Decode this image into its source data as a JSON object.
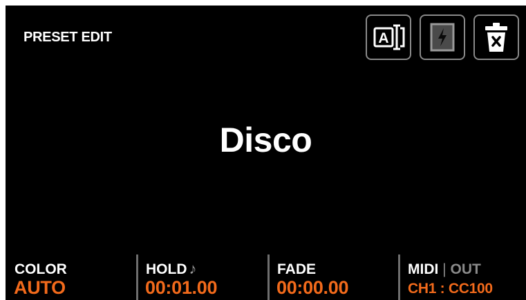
{
  "header": {
    "title": "PRESET EDIT"
  },
  "toolbar": {
    "rename_icon": "rename-text-icon",
    "trigger_icon": "lightning-icon",
    "delete_icon": "trash-icon"
  },
  "preset": {
    "name": "Disco"
  },
  "params": {
    "color": {
      "label": "COLOR",
      "value": "AUTO"
    },
    "hold": {
      "label": "HOLD",
      "icon": "music-note-icon",
      "value": "00:01.00"
    },
    "fade": {
      "label": "FADE",
      "value": "00:00.00"
    },
    "midi": {
      "label": "MIDI",
      "separator": "|",
      "out_label": "OUT",
      "value": "CH1 : CC100"
    }
  },
  "colors": {
    "accent": "#f26a1b",
    "background": "#000000",
    "text": "#ffffff",
    "muted": "#8a8a8a"
  }
}
